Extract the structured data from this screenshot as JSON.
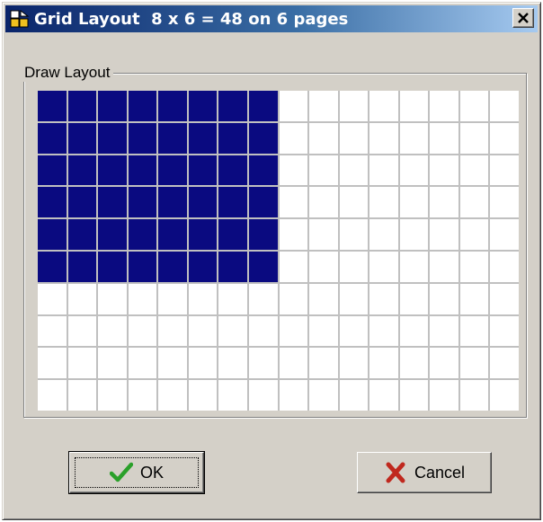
{
  "window": {
    "title": "Grid Layout  8 x 6 = 48 on 6 pages"
  },
  "group": {
    "label": "Draw Layout"
  },
  "grid": {
    "columns": 16,
    "rows": 10,
    "selected_columns": 8,
    "selected_rows": 6,
    "selected_color": "#0a0a80",
    "empty_color": "#ffffff"
  },
  "buttons": {
    "ok_label": "OK",
    "cancel_label": "Cancel"
  },
  "icons": {
    "app": "app-icon",
    "close": "close-icon",
    "ok": "checkmark-icon",
    "cancel": "x-mark-icon"
  }
}
